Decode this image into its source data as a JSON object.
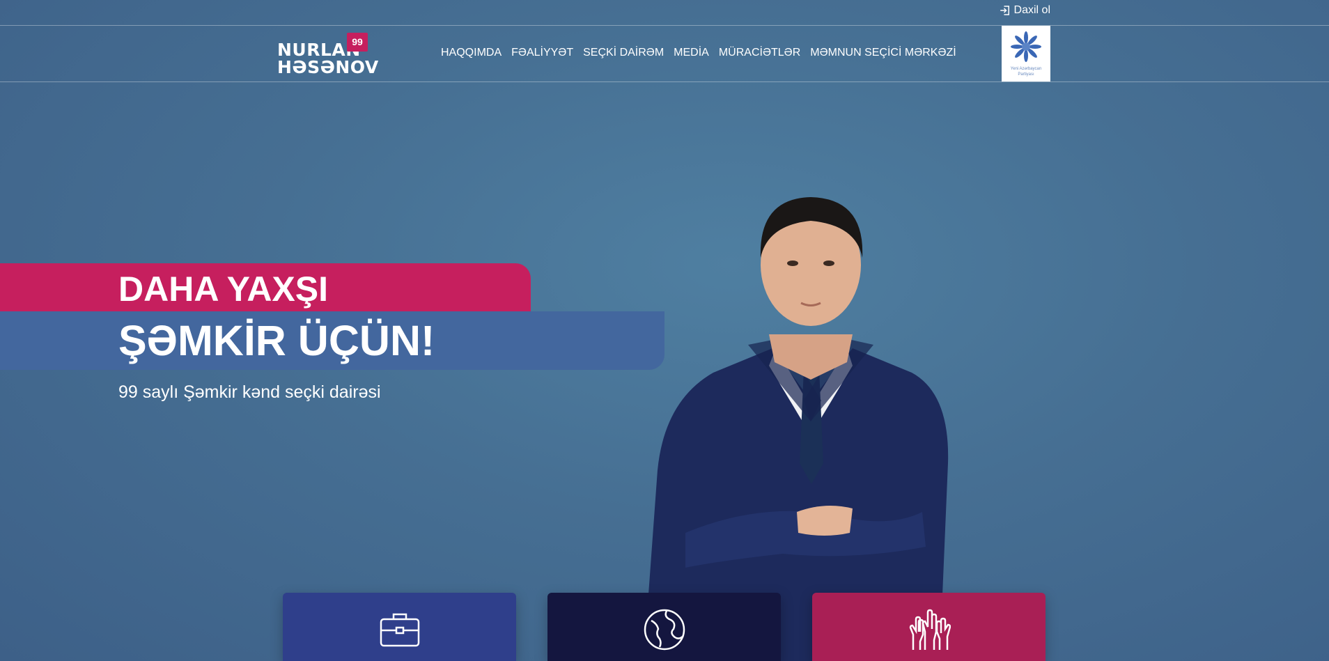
{
  "topbar": {
    "login_label": "Daxil ol"
  },
  "header": {
    "logo": {
      "line1": "NURLAN",
      "line2": "HƏSƏNOV",
      "badge": "99"
    },
    "nav": [
      {
        "label": "HAQQIMDA"
      },
      {
        "label": "FƏALİYYƏT"
      },
      {
        "label": "SEÇKİ DAİRƏM"
      },
      {
        "label": "MEDİA"
      },
      {
        "label": "MÜRACİƏTLƏR"
      },
      {
        "label": "MƏMNUN SEÇİCİ MƏRKƏZİ"
      }
    ],
    "party_logo": {
      "caption_line1": "Yeni Azərbaycan",
      "caption_line2": "Partiyası"
    }
  },
  "hero": {
    "title_line1": "DAHA YAXŞI",
    "title_line2": "ŞƏMKİR ÜÇÜN!",
    "subtitle": "99 saylı Şəmkir kənd seçki dairəsi"
  },
  "cards": [
    {
      "icon": "briefcase-icon",
      "color": "#2f3f8b"
    },
    {
      "icon": "globe-icon",
      "color": "#14163f"
    },
    {
      "icon": "raised-hands-icon",
      "color": "#a91f55"
    }
  ],
  "colors": {
    "accent_pink": "#c61f5e",
    "accent_blue": "#43679e",
    "background": "#466f93"
  }
}
